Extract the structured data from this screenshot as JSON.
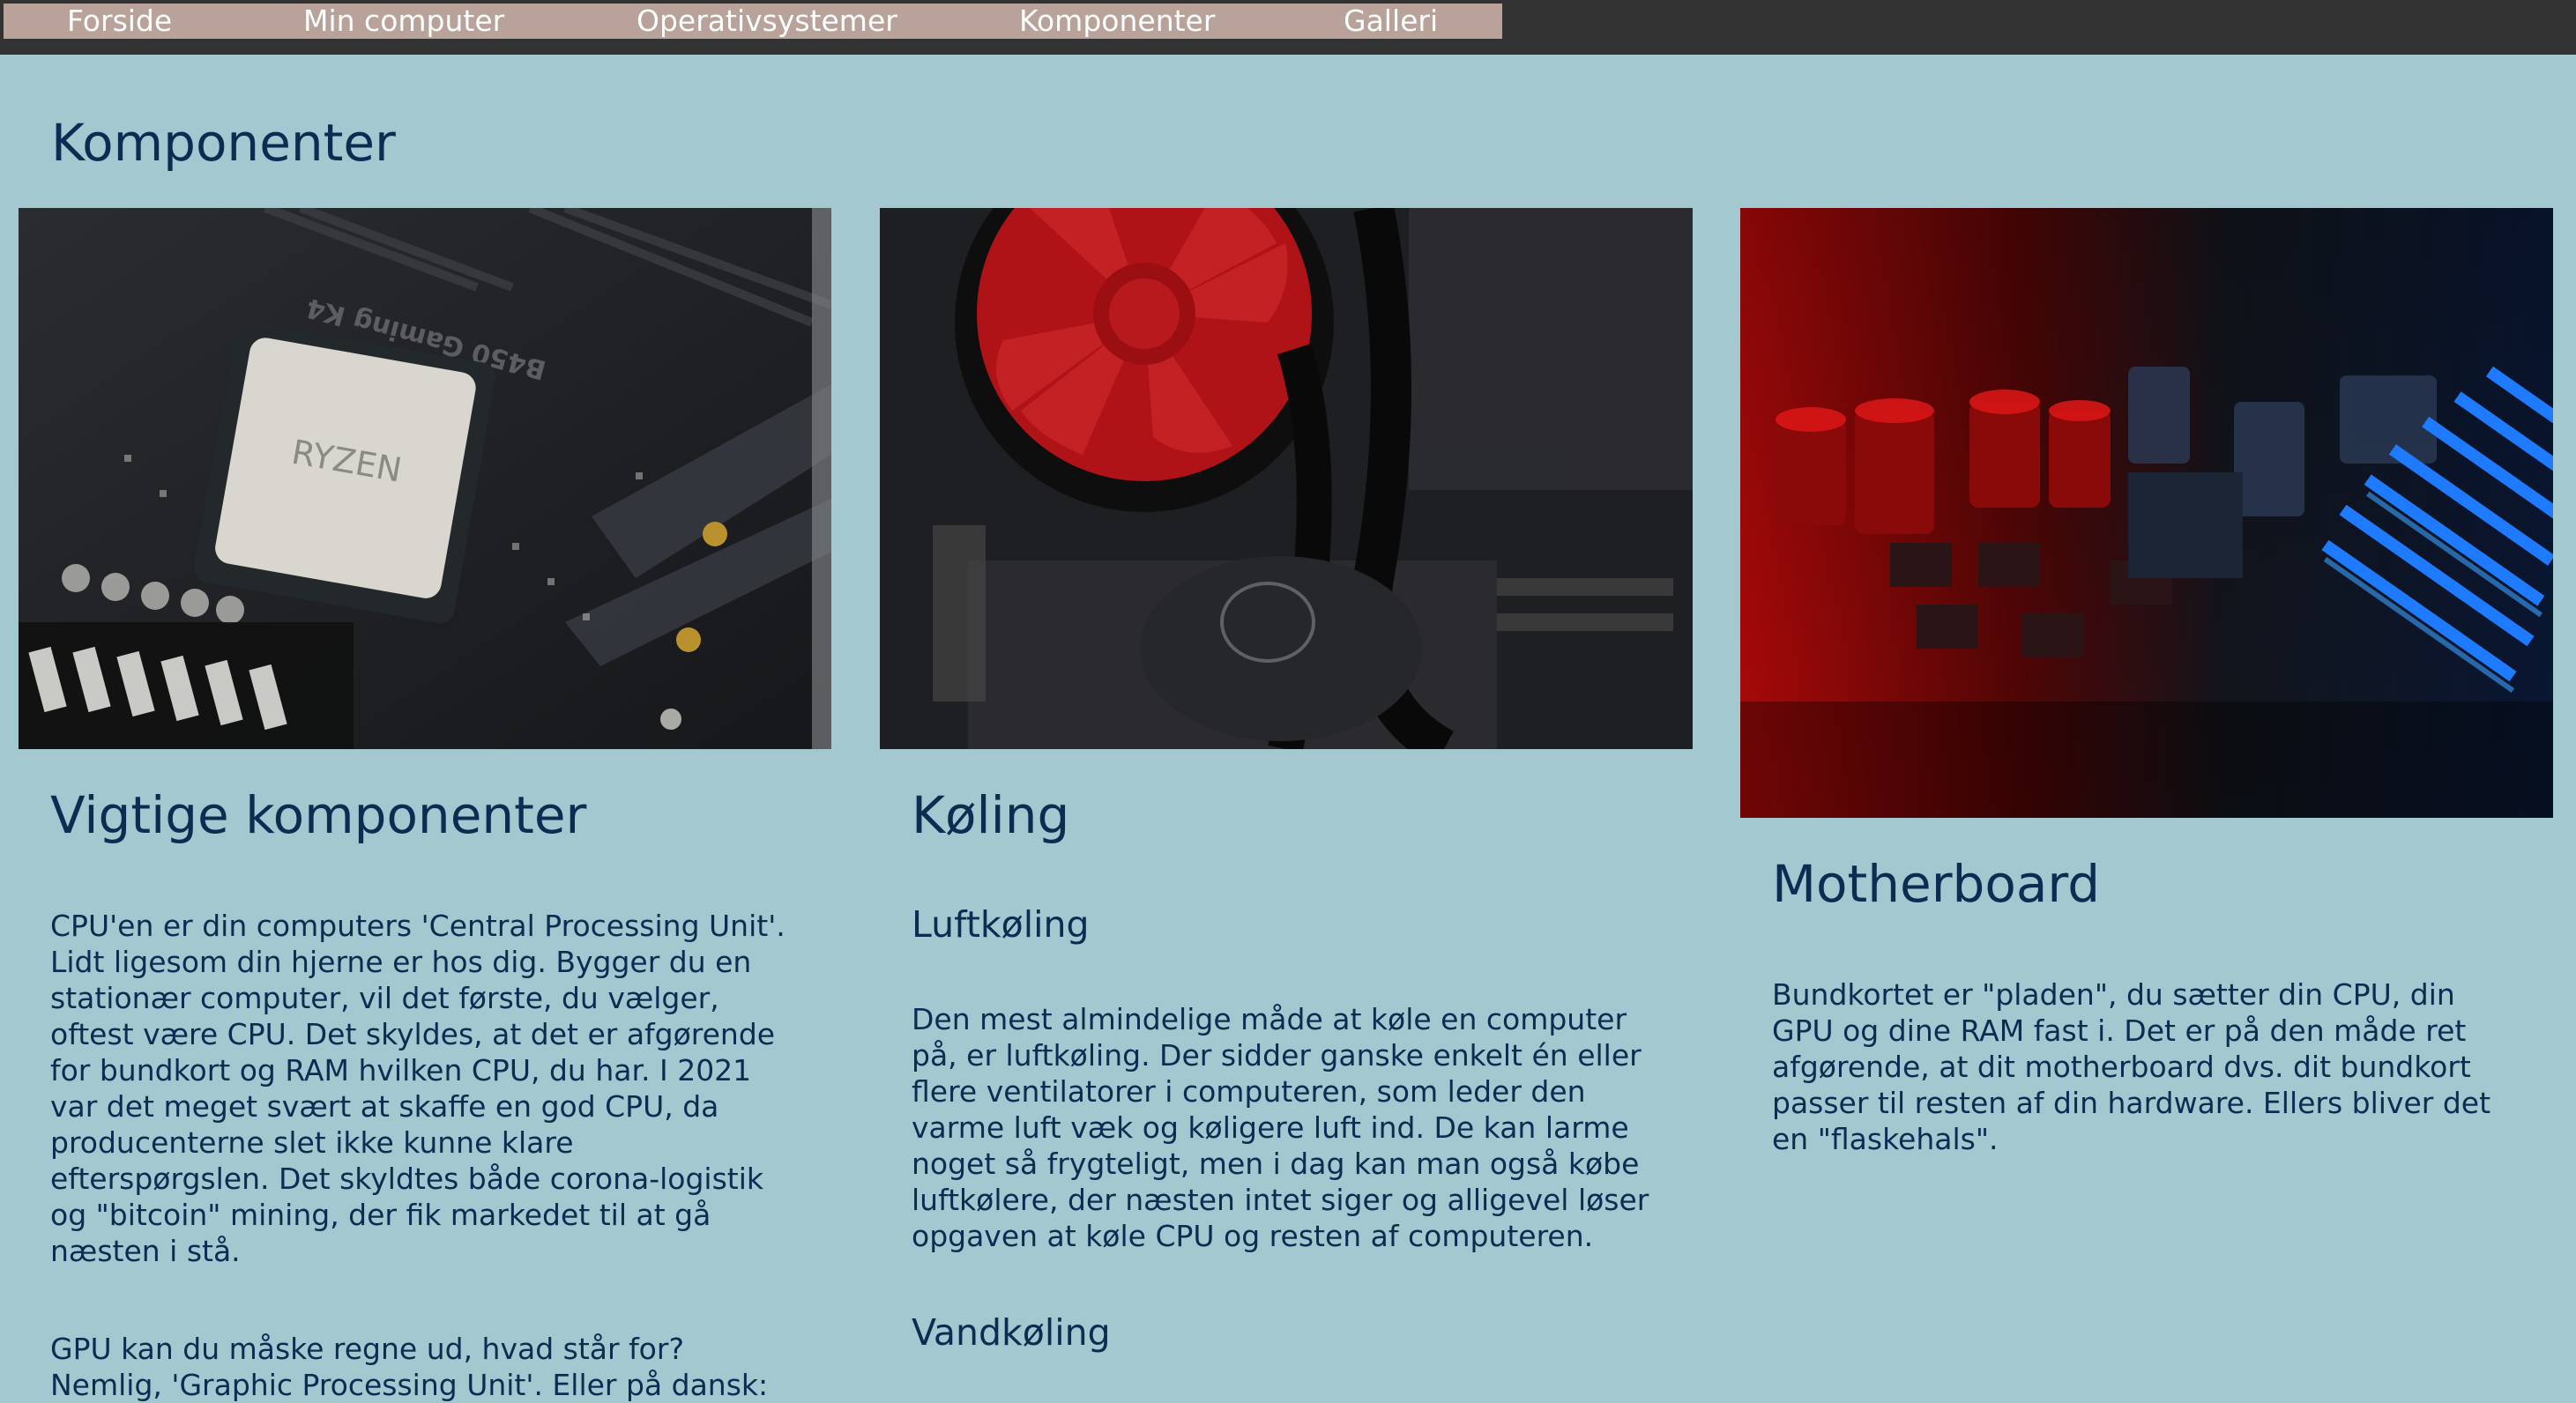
{
  "nav": {
    "items": [
      {
        "label": "Forside"
      },
      {
        "label": "Min computer"
      },
      {
        "label": "Operativsystemer"
      },
      {
        "label": "Komponenter"
      },
      {
        "label": "Galleri"
      }
    ]
  },
  "page": {
    "title": "Komponenter"
  },
  "columns": [
    {
      "heading": "Vigtige komponenter",
      "paragraphs": [
        "CPU'en er din computers 'Central Processing Unit'. Lidt ligesom din hjerne er hos dig. Bygger du en stationær computer, vil det første, du vælger, oftest være CPU. Det skyldes, at det er afgørende for bundkort og RAM hvilken CPU, du har. I 2021 var det meget svært at skaffe en god CPU, da producenterne slet ikke kunne klare efterspørgslen. Det skyldtes både corona-logistik og \"bitcoin\" mining, der fik markedet til at gå næsten i stå.",
        "GPU kan du måske regne ud, hvad står for? Nemlig, 'Graphic Processing Unit'. Eller på dansk:"
      ]
    },
    {
      "heading": "Køling",
      "subheading1": "Luftkøling",
      "paragraph1": "Den mest almindelige måde at køle en computer på, er luftkøling. Der sidder ganske enkelt én eller flere ventilatorer i computeren, som leder den varme luft væk og køligere luft ind. De kan larme noget så frygteligt, men i dag kan man også købe luftkølere, der næsten intet siger og alligevel løser opgaven at køle CPU og resten af computeren.",
      "subheading2": "Vandkøling"
    },
    {
      "heading": "Motherboard",
      "paragraphs": [
        "Bundkortet er \"pladen\", du sætter din CPU, din GPU og dine RAM fast i. Det er på den måde ret afgørende, at dit motherboard dvs. dit bundkort passer til resten af din hardware. Ellers bliver det en \"flaskehals\"."
      ]
    }
  ],
  "images": {
    "cpu_chip_label": "RYZEN",
    "board_label": "B450 Gaming K4"
  },
  "colors": {
    "background": "#a3c8d0",
    "topbar": "#333333",
    "nav": "#b8a29a",
    "text": "#0d2c52"
  }
}
